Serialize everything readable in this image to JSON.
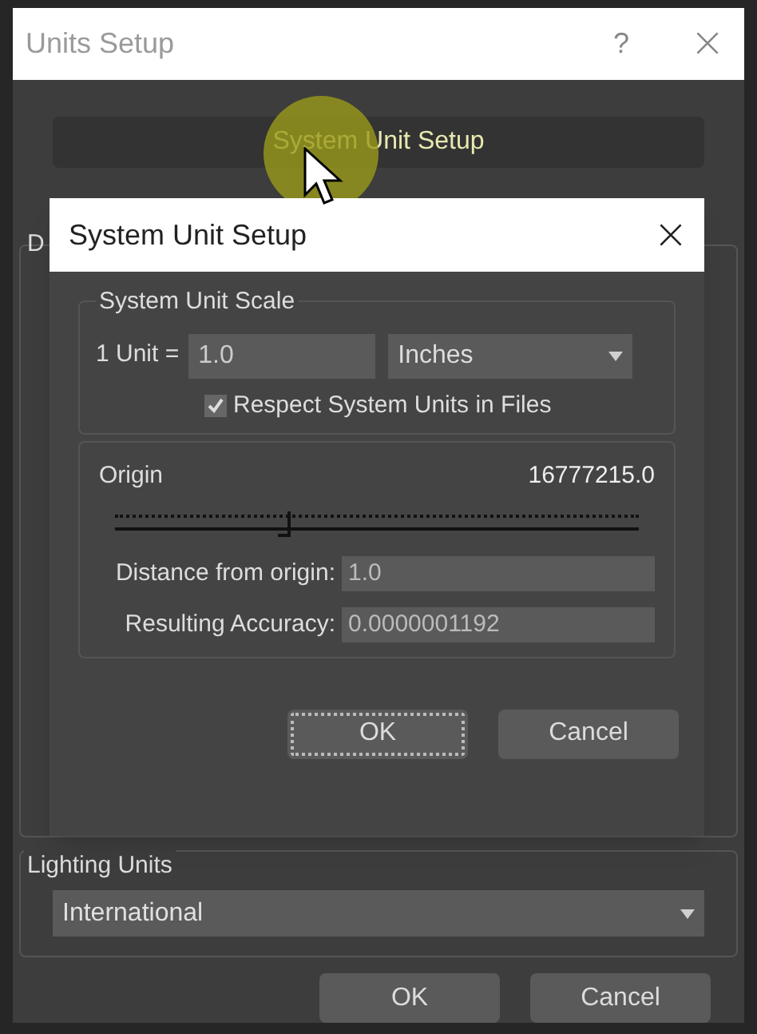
{
  "window": {
    "title": "Units Setup",
    "help": "?"
  },
  "setup_button": {
    "label": "System Unit Setup"
  },
  "group_label": "D",
  "lighting": {
    "label": "Lighting Units",
    "value": "International"
  },
  "buttons": [
    {
      "label": "OK",
      "focused": false
    },
    {
      "label": "Cancel",
      "focused": false
    }
  ],
  "dialog": {
    "title": "System Unit Setup",
    "scale": {
      "title": "System Unit Scale",
      "unit_label": "1 Unit =",
      "unit_value": "1.0",
      "unit_type": "Inches",
      "respect": {
        "label": "Respect System Units in Files",
        "checked": true
      }
    },
    "origin": {
      "label": "Origin",
      "reading": "16777215.0",
      "level": 0.33,
      "fields": [
        {
          "label": "Distance from origin:",
          "value": "1.0"
        },
        {
          "label": "Resulting Accuracy:",
          "value": "0.0000001192"
        }
      ]
    },
    "buttons": [
      {
        "label": "OK",
        "focused": true
      },
      {
        "label": "Cancel",
        "focused": false
      }
    ]
  }
}
